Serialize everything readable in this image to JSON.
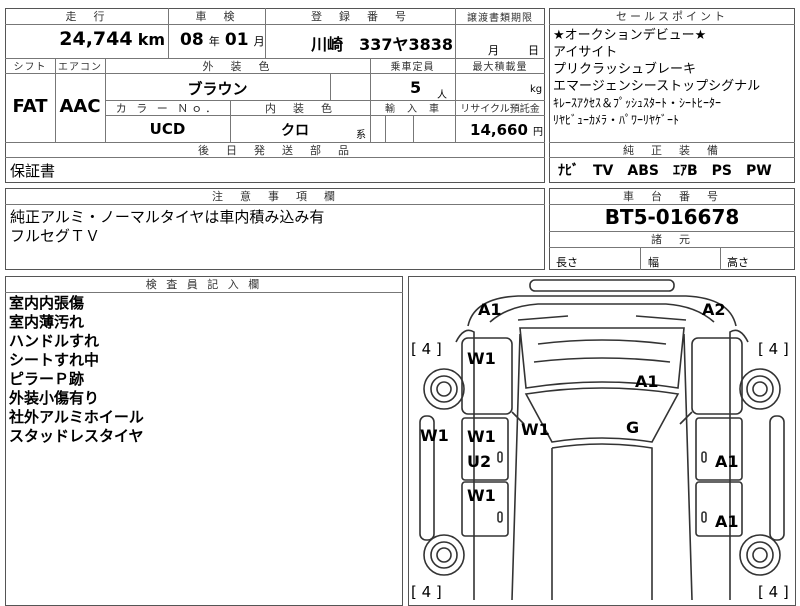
{
  "top_table": {
    "headers": {
      "mileage": "走　行",
      "inspection": "車　検",
      "registration": "登　録　番　号",
      "transfer": "譲渡書類期限",
      "shift": "シフト",
      "aircon": "エアコン",
      "exterior": "外　装　色",
      "capacity": "乗車定員",
      "max_load": "最大積載量",
      "color_no": "カ ラ ー Ｎｏ．",
      "interior": "内　装　色",
      "import": "輸　入　車",
      "recycle": "リサイクル預託金",
      "later_parts": "後　日　発　送　部　品"
    },
    "mileage_value": "24,744",
    "mileage_unit": "km",
    "inspection_year": "08",
    "inspection_year_unit": "年",
    "inspection_month": "01",
    "inspection_month_unit": "月",
    "registration_value": "川崎　337ヤ3838",
    "transfer_month_unit": "月",
    "transfer_day_unit": "日",
    "shift_value": "FAT",
    "aircon_value": "AAC",
    "exterior_value": "ブラウン",
    "capacity_value": "5",
    "capacity_unit": "人",
    "max_load_unit": "kg",
    "color_no_value": "UCD",
    "interior_value": "クロ",
    "interior_suffix": "系",
    "recycle_value": "14,660",
    "recycle_unit": "円",
    "later_parts_value": "保証書"
  },
  "sales_points": {
    "header": "セールスポイント",
    "items": [
      "★オークションデビュー★",
      "アイサイト",
      "プリクラッシュブレーキ",
      "エマージェンシーストップシグナル",
      "ｷﾚｰｽｱｸｾｽ＆ﾌﾟｯｼｭｽﾀｰﾄ・ｼｰﾄﾋｰﾀｰ",
      "ﾘﾔﾋﾞｭｰｶﾒﾗ・ﾊﾟﾜｰﾘﾔｹﾞｰﾄ"
    ]
  },
  "genuine_equipment": {
    "header": "純　正　装　備",
    "value": "ﾅﾋﾞ　TV　ABS　ｴｱB　PS　PW"
  },
  "notes": {
    "header": "注　意　事　項　欄",
    "lines": [
      "純正アルミ・ノーマルタイヤは車内積み込み有",
      "フルセグＴＶ"
    ]
  },
  "chassis": {
    "header": "車　台　番　号",
    "value": "BT5-016678"
  },
  "specs": {
    "header": "諸　元",
    "length_label": "長さ",
    "width_label": "幅",
    "height_label": "高さ"
  },
  "inspector": {
    "header": "検 査 員 記 入 欄",
    "lines": [
      "室内内張傷",
      "室内薄汚れ",
      "ハンドルすれ",
      "シートすれ中",
      "ピラーＰ跡",
      "外装小傷有り",
      "社外アルミホイール",
      "スタッドレスタイヤ"
    ]
  },
  "diagram": {
    "marks": {
      "fl_corner": "A1",
      "fr_corner": "A2",
      "hood": "A1",
      "windshield": "G",
      "left_front_fender": "W1",
      "left_side_outer": "W1",
      "left_front_door": "W1",
      "left_step": "U2",
      "left_rear_door": "W1",
      "left_pillar": "W1",
      "right_front_door": "A1",
      "right_rear_door": "A1"
    },
    "tire_labels": {
      "front_left": "[ 4 ]",
      "front_right": "[ 4 ]",
      "rear_left": "[ 4 ]",
      "rear_right": "[ 4 ]"
    }
  }
}
